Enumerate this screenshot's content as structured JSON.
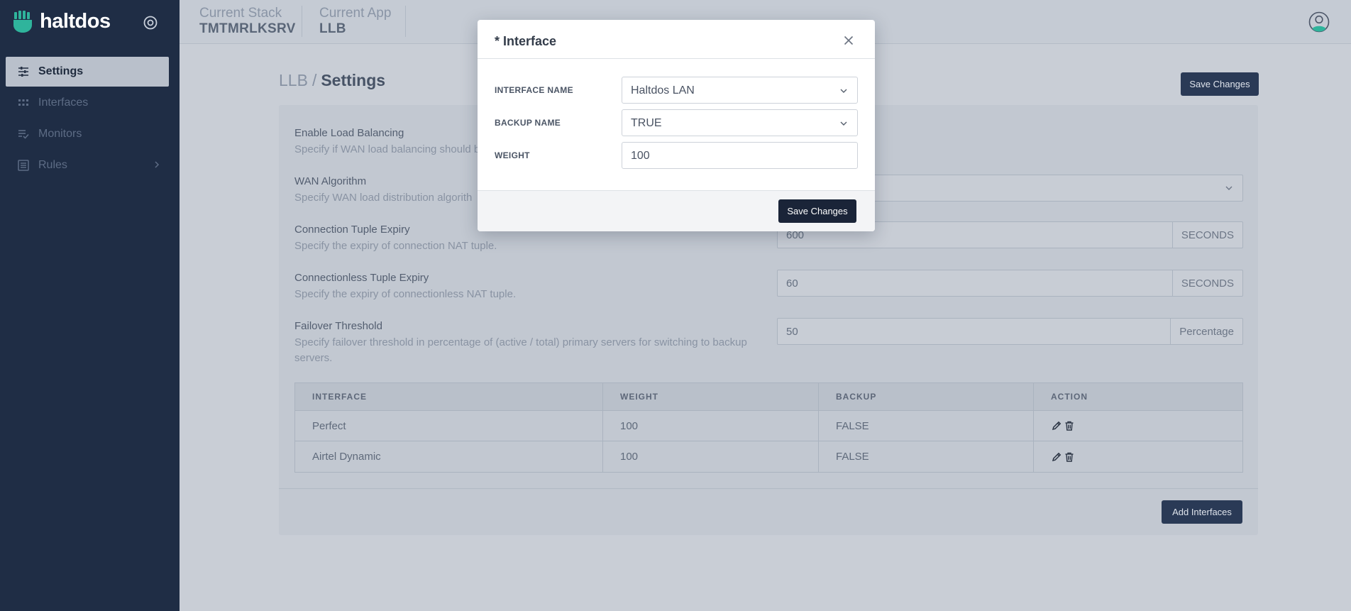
{
  "brand": {
    "name": "haltdos",
    "accent_color": "#2fb49c"
  },
  "sidebar": {
    "items": [
      {
        "label": "Settings",
        "icon": "sliders-icon",
        "active": true
      },
      {
        "label": "Interfaces",
        "icon": "grid-icon",
        "active": false
      },
      {
        "label": "Monitors",
        "icon": "checklist-icon",
        "active": false
      },
      {
        "label": "Rules",
        "icon": "list-icon",
        "active": false,
        "has_submenu": true
      }
    ]
  },
  "topbar": {
    "stack_label": "Current Stack",
    "stack_value": "TMTMRLKSRV",
    "app_label": "Current App",
    "app_value": "LLB"
  },
  "page": {
    "breadcrumb_parent": "LLB",
    "breadcrumb_sep": "/",
    "breadcrumb_current": "Settings",
    "save_label": "Save Changes",
    "add_interfaces_label": "Add Interfaces"
  },
  "settings": {
    "load_balancing": {
      "title": "Enable Load Balancing",
      "desc": "Specify if WAN load balancing should b"
    },
    "wan_algorithm": {
      "title": "WAN Algorithm",
      "desc": "Specify WAN load distribution algorith"
    },
    "conn_tuple": {
      "title": "Connection Tuple Expiry",
      "desc": "Specify the expiry of connection NAT tuple.",
      "value": "600",
      "unit": "SECONDS"
    },
    "connless_tuple": {
      "title": "Connectionless Tuple Expiry",
      "desc": "Specify the expiry of connectionless NAT tuple.",
      "value": "60",
      "unit": "SECONDS"
    },
    "failover": {
      "title": "Failover Threshold",
      "desc": "Specify failover threshold in percentage of (active / total) primary servers for switching to backup servers.",
      "value": "50",
      "unit": "Percentage"
    }
  },
  "table": {
    "headers": [
      "INTERFACE",
      "WEIGHT",
      "BACKUP",
      "ACTION"
    ],
    "rows": [
      {
        "interface": "Perfect",
        "weight": "100",
        "backup": "FALSE"
      },
      {
        "interface": "Airtel Dynamic",
        "weight": "100",
        "backup": "FALSE"
      }
    ]
  },
  "modal": {
    "title": "* Interface",
    "interface_name_label": "INTERFACE NAME",
    "interface_name_value": "Haltdos LAN",
    "backup_name_label": "BACKUP NAME",
    "backup_name_value": "TRUE",
    "weight_label": "WEIGHT",
    "weight_value": "100",
    "save_label": "Save Changes"
  }
}
